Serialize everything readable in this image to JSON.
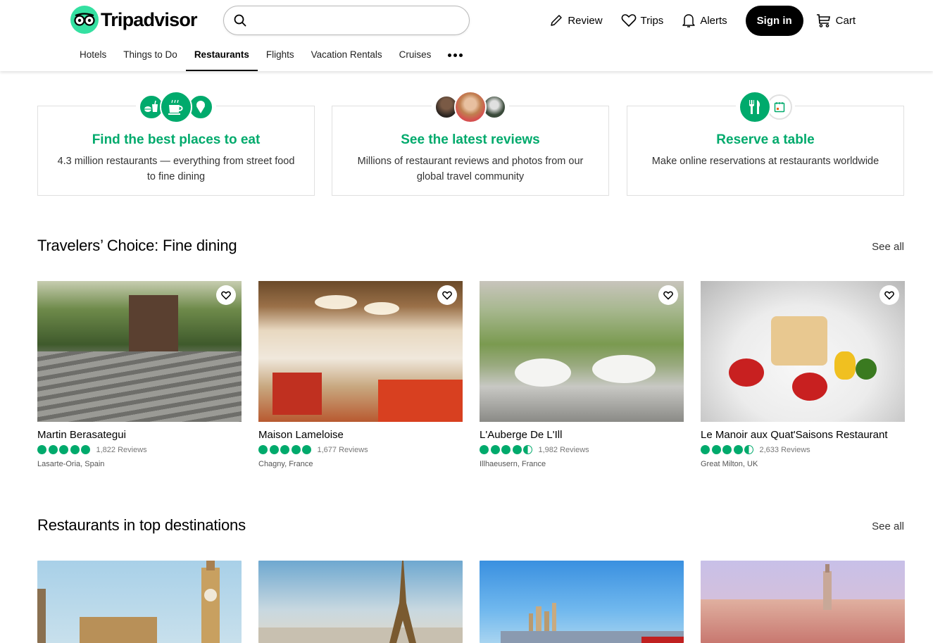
{
  "header": {
    "brand": "Tripadvisor",
    "search": {
      "value": "",
      "placeholder": ""
    },
    "actions": [
      {
        "label": "Review",
        "icon": "pencil-icon"
      },
      {
        "label": "Trips",
        "icon": "heart-icon"
      },
      {
        "label": "Alerts",
        "icon": "bell-icon"
      }
    ],
    "signin_label": "Sign in",
    "cart_label": "Cart",
    "nav": [
      {
        "label": "Hotels",
        "active": false
      },
      {
        "label": "Things to Do",
        "active": false
      },
      {
        "label": "Restaurants",
        "active": true
      },
      {
        "label": "Flights",
        "active": false
      },
      {
        "label": "Vacation Rentals",
        "active": false
      },
      {
        "label": "Cruises",
        "active": false
      }
    ],
    "nav_more_icon": "more-dots-icon"
  },
  "features": [
    {
      "title": "Find the best places to eat",
      "text": "4.3 million restaurants — everything from street food to fine dining",
      "icons": [
        "fast-food-icon",
        "coffee-cup-icon",
        "ice-cream-icon"
      ]
    },
    {
      "title": "See the latest reviews",
      "text": "Millions of restaurant reviews and photos from our global travel community",
      "icons": [
        "reviewer-avatar",
        "reviewer-avatar",
        "reviewer-avatar"
      ]
    },
    {
      "title": "Reserve a table",
      "text": "Make online reservations at restaurants worldwide",
      "icons": [
        "fork-knife-icon",
        "calendar-icon"
      ]
    }
  ],
  "travelers_choice": {
    "title": "Travelers’ Choice: Fine dining",
    "see_all": "See all",
    "items": [
      {
        "name": "Martin Berasategui",
        "rating": 5,
        "reviews": "1,822 Reviews",
        "location": "Lasarte-Oria, Spain"
      },
      {
        "name": "Maison Lameloise",
        "rating": 5,
        "reviews": "1,677 Reviews",
        "location": "Chagny, France"
      },
      {
        "name": "L'Auberge De L'Ill",
        "rating": 4.5,
        "reviews": "1,982 Reviews",
        "location": "Illhaeusern, France"
      },
      {
        "name": "Le Manoir aux Quat'Saisons Restaurant",
        "rating": 4.5,
        "reviews": "2,633 Reviews",
        "location": "Great Milton, UK"
      }
    ]
  },
  "top_destinations": {
    "title": "Restaurants in top destinations",
    "see_all": "See all",
    "images": [
      "london-photo",
      "paris-photo",
      "dubai-photo",
      "istanbul-photo"
    ]
  },
  "colors": {
    "brand_green": "#00aa6c",
    "logo_green": "#34e0a1"
  }
}
